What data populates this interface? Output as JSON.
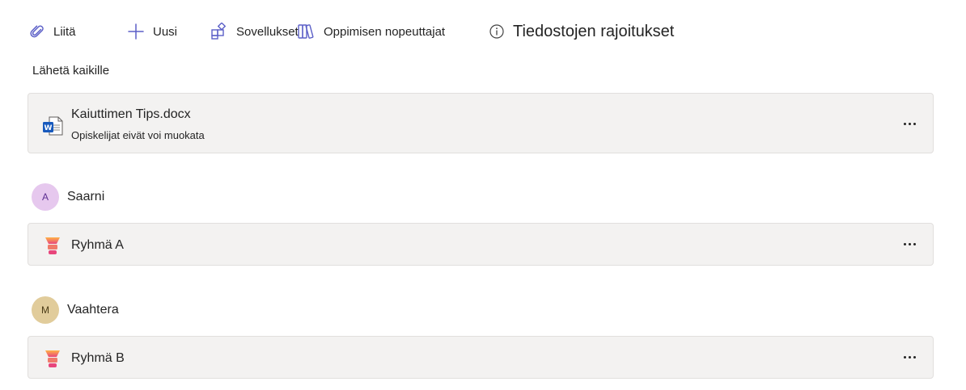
{
  "toolbar": {
    "attach_label": "Liitä",
    "new_label": "Uusi",
    "apps_label": "Sovellukset",
    "accelerators_label": "Oppimisen nopeuttajat",
    "file_limits_label": "Tiedostojen rajoitukset"
  },
  "section": {
    "label": "Lähetä kaikille"
  },
  "file": {
    "name": "Kaiuttimen Tips.docx",
    "subtitle": "Opiskelijat eivät voi muokata",
    "icon": "word-doc-icon",
    "accent": "#185abd"
  },
  "students": [
    {
      "initial": "A",
      "name": "Saarni",
      "avatar_color": "#e6c8ee",
      "group": {
        "name": "Ryhmä A",
        "icon": "group-icon"
      }
    },
    {
      "initial": "M",
      "name": "Vaahtera",
      "avatar_color": "#e1cc9b",
      "group": {
        "name": "Ryhmä B",
        "icon": "group-icon"
      }
    }
  ]
}
